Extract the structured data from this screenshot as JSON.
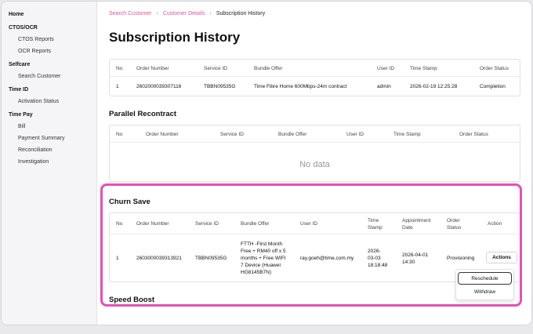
{
  "sidebar": {
    "sections": [
      {
        "heading": "Home",
        "items": []
      },
      {
        "heading": "CTOS/OCR",
        "items": [
          "CTOS Reports",
          "OCR Reports"
        ]
      },
      {
        "heading": "Selfcare",
        "items": [
          "Search Customer"
        ]
      },
      {
        "heading": "Time ID",
        "items": [
          "Activation Status"
        ]
      },
      {
        "heading": "Time Pay",
        "items": [
          "Bill",
          "Payment Summary",
          "Reconciliation",
          "Investigation"
        ]
      }
    ]
  },
  "breadcrumb": [
    "Search Customer",
    "Customer Details",
    "Subscription History"
  ],
  "page_title": "Subscription History",
  "subscription": {
    "headers": [
      "No",
      "Order Number",
      "Service ID",
      "Bundle Offer",
      "User ID",
      "Time Stamp",
      "Order Status"
    ],
    "rows": [
      [
        "1",
        "2602000039307116",
        "TBBN09535G",
        "Time Fibre Home 600Mbps-24m contract",
        "admin",
        "2026-02-19 12:25:28",
        "Completion"
      ]
    ]
  },
  "parallel": {
    "title": "Parallel Recontract",
    "headers": [
      "No",
      "Order Number",
      "Service ID",
      "Bundle Offer",
      "User ID",
      "Time Stamp",
      "Order Status"
    ],
    "empty_text": "No data"
  },
  "churn": {
    "title": "Churn Save",
    "headers": [
      "No",
      "Order Number",
      "Service ID",
      "Bundle Offer",
      "User ID",
      "Time Stamp",
      "Appointment Date",
      "Order Status",
      "Action"
    ],
    "row": {
      "no": "1",
      "order_number": "2603000039313921",
      "service_id": "TBBN09535G",
      "bundle_offer": [
        "FTTH -First Month",
        "Free + RM40 off x 5",
        "months + Free WIFI",
        "7 Device (Huawei",
        "HG8145B7N)"
      ],
      "user_id": "ray.goeh@time.com.my",
      "time_stamp": [
        "2026-",
        "03-03",
        "18:18:48"
      ],
      "appointment": [
        "2026-04-01",
        "14:30"
      ],
      "status": "Provisioning",
      "action_label": "Actions"
    },
    "menu": [
      "Reschedule",
      "Withdraw"
    ]
  },
  "speed_boost": {
    "title": "Speed Boost"
  },
  "colors": {
    "accent": "#e0559e",
    "highlight": "#e64fb8"
  }
}
